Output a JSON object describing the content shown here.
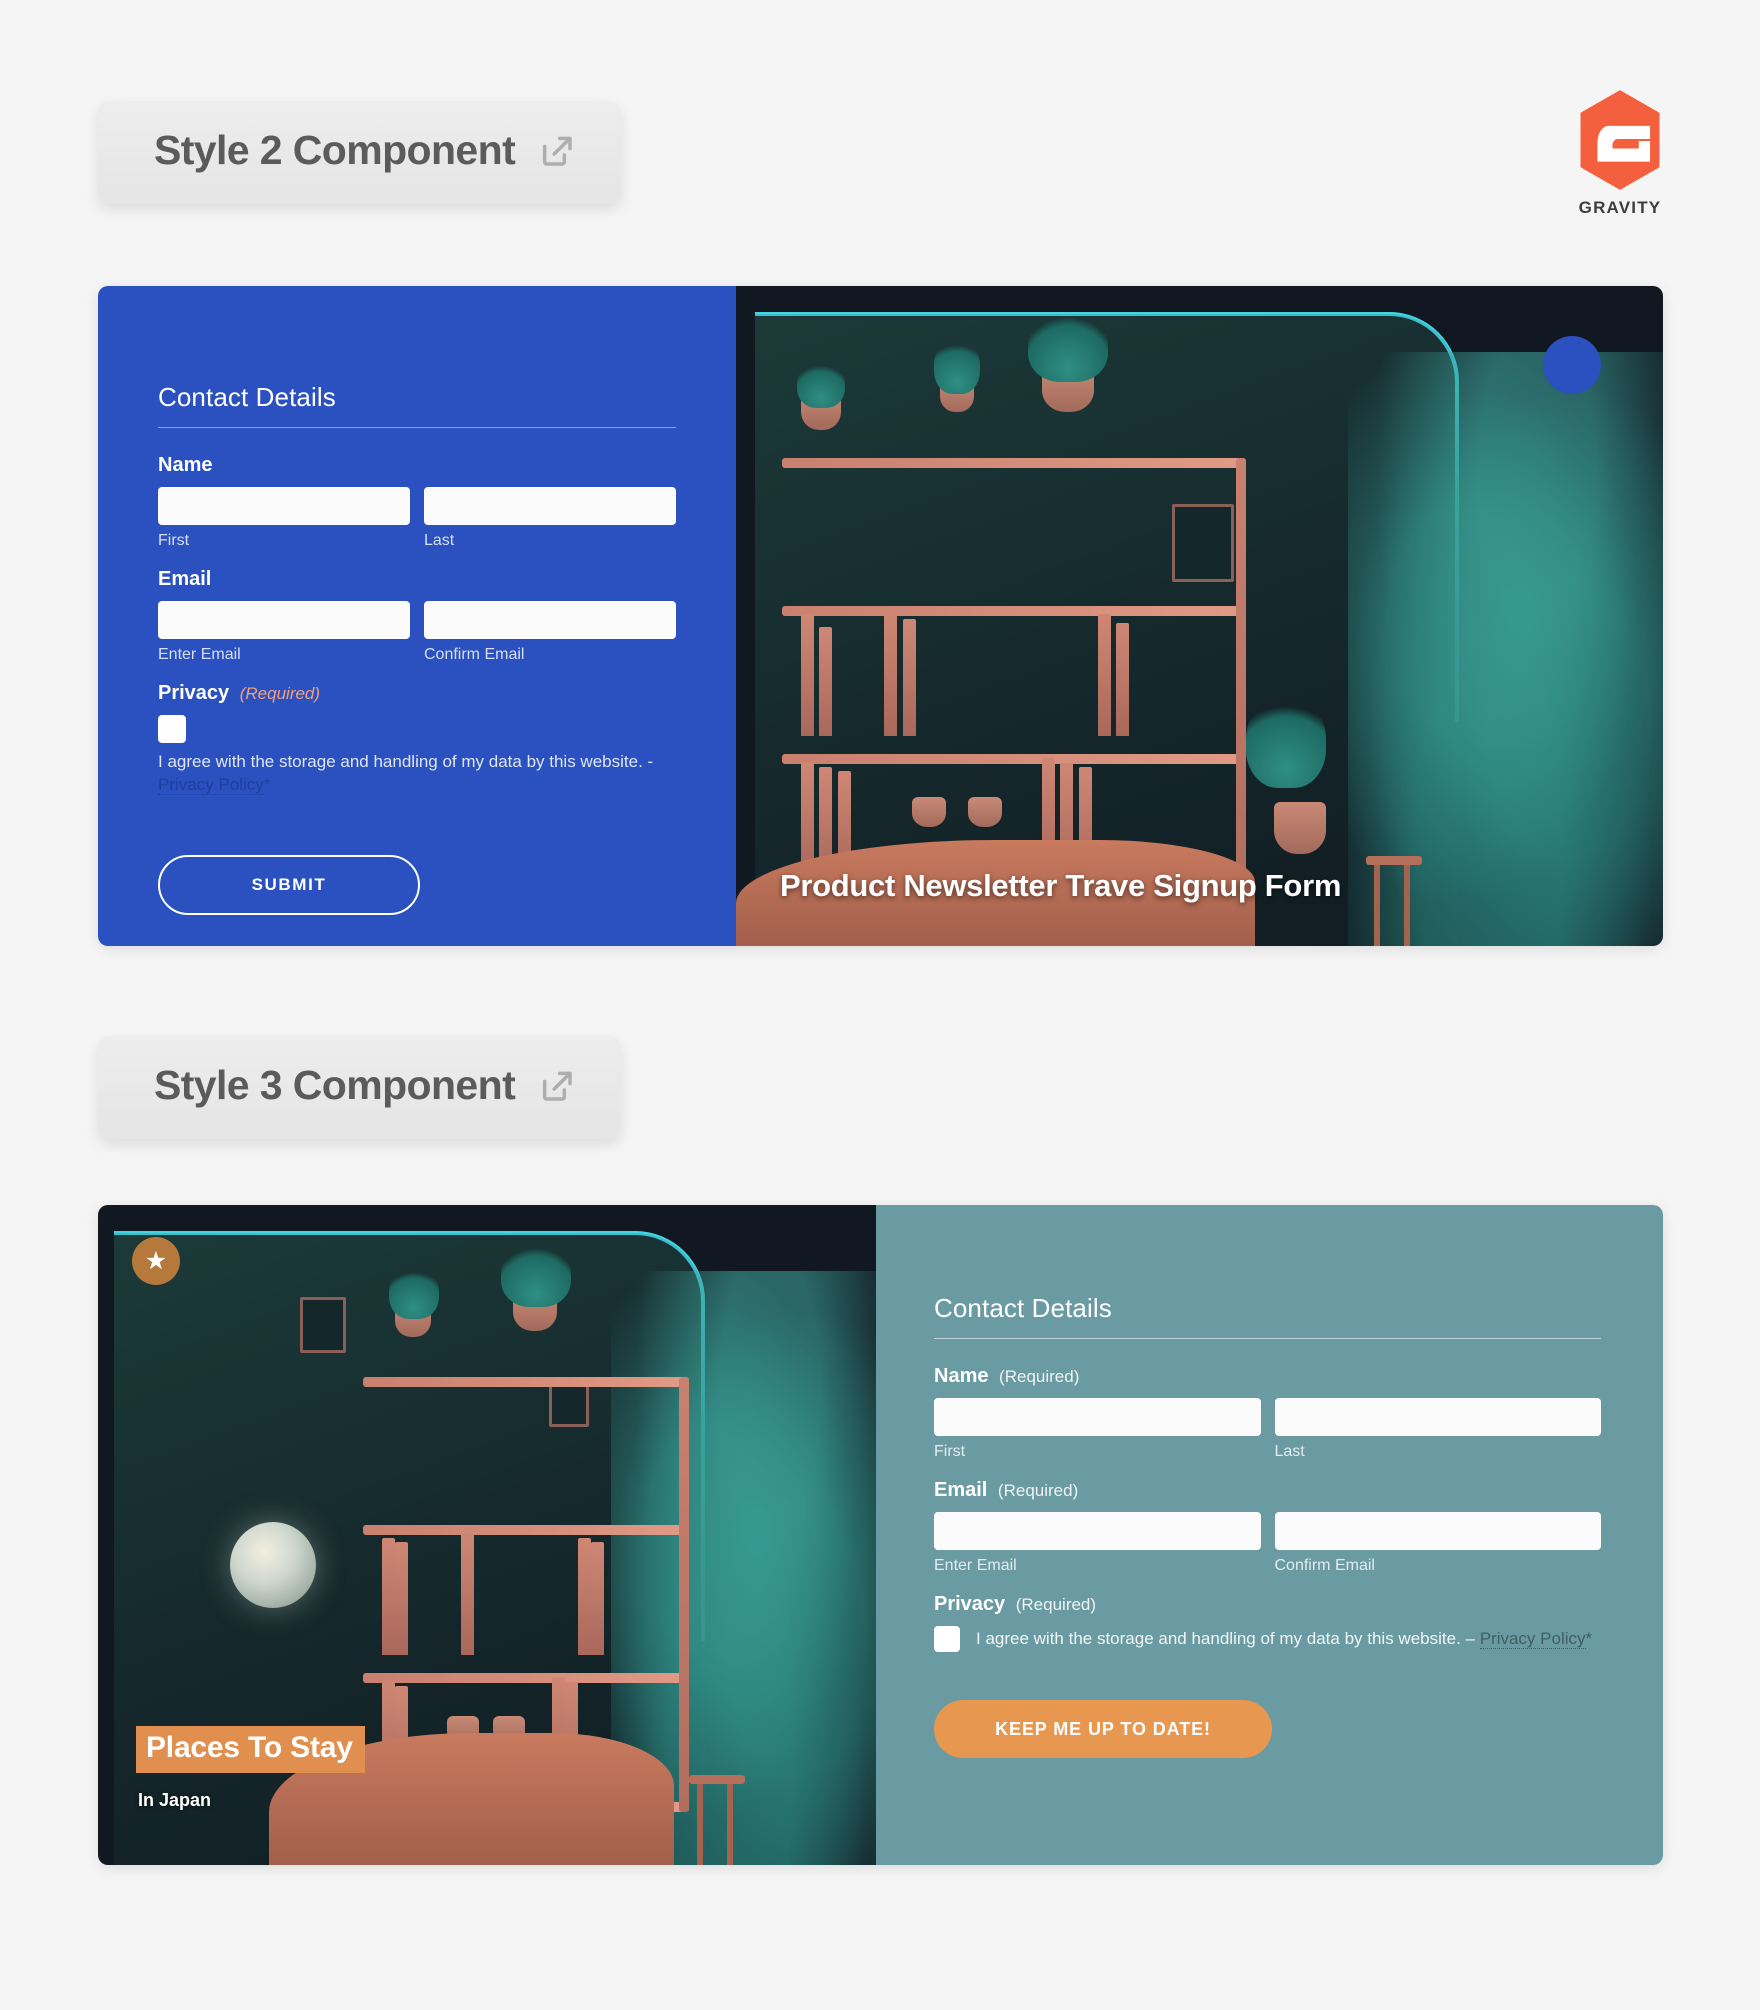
{
  "brand": {
    "logo_name": "gravity-hex-logo",
    "wordmark": "GRAVITY",
    "accent_orange": "#F4603E"
  },
  "sections": [
    {
      "badge_label": "Style 2 Component",
      "badge_icon": "external-link-icon",
      "panel_color": "#2a51bf",
      "form": {
        "title": "Contact Details",
        "name": {
          "label": "Name",
          "required_note": "",
          "first_sub": "First",
          "last_sub": "Last"
        },
        "email": {
          "label": "Email",
          "required_note": "",
          "enter_sub": "Enter Email",
          "confirm_sub": "Confirm Email"
        },
        "privacy": {
          "label": "Privacy",
          "required_note": "(Required)",
          "consent_text": "I agree with the storage and handling of my data by this website. -",
          "policy_link": "Privacy Policy",
          "asterisk": "*"
        },
        "submit_label": "SUBMIT"
      },
      "image": {
        "caption": "Product Newsletter Trave Signup Form",
        "badge_shape": "blue-circle",
        "badge_color": "#2a51bf"
      }
    },
    {
      "badge_label": "Style 3 Component",
      "badge_icon": "external-link-icon",
      "panel_color": "#6a9ba3",
      "form": {
        "title": "Contact Details",
        "name": {
          "label": "Name",
          "required_note": "(Required)",
          "first_sub": "First",
          "last_sub": "Last"
        },
        "email": {
          "label": "Email",
          "required_note": "(Required)",
          "enter_sub": "Enter Email",
          "confirm_sub": "Confirm Email"
        },
        "privacy": {
          "label": "Privacy",
          "required_note": "(Required)",
          "consent_text": "I agree with the storage and handling of my data by this website. –",
          "policy_link": "Privacy Policy",
          "asterisk": "*"
        },
        "submit_label": "KEEP ME UP TO DATE!",
        "submit_color": "#e89751"
      },
      "image": {
        "tag": "Places To Stay",
        "subtitle": "In Japan",
        "star_icon": "star-icon",
        "tag_color": "#e08f4e"
      }
    }
  ]
}
